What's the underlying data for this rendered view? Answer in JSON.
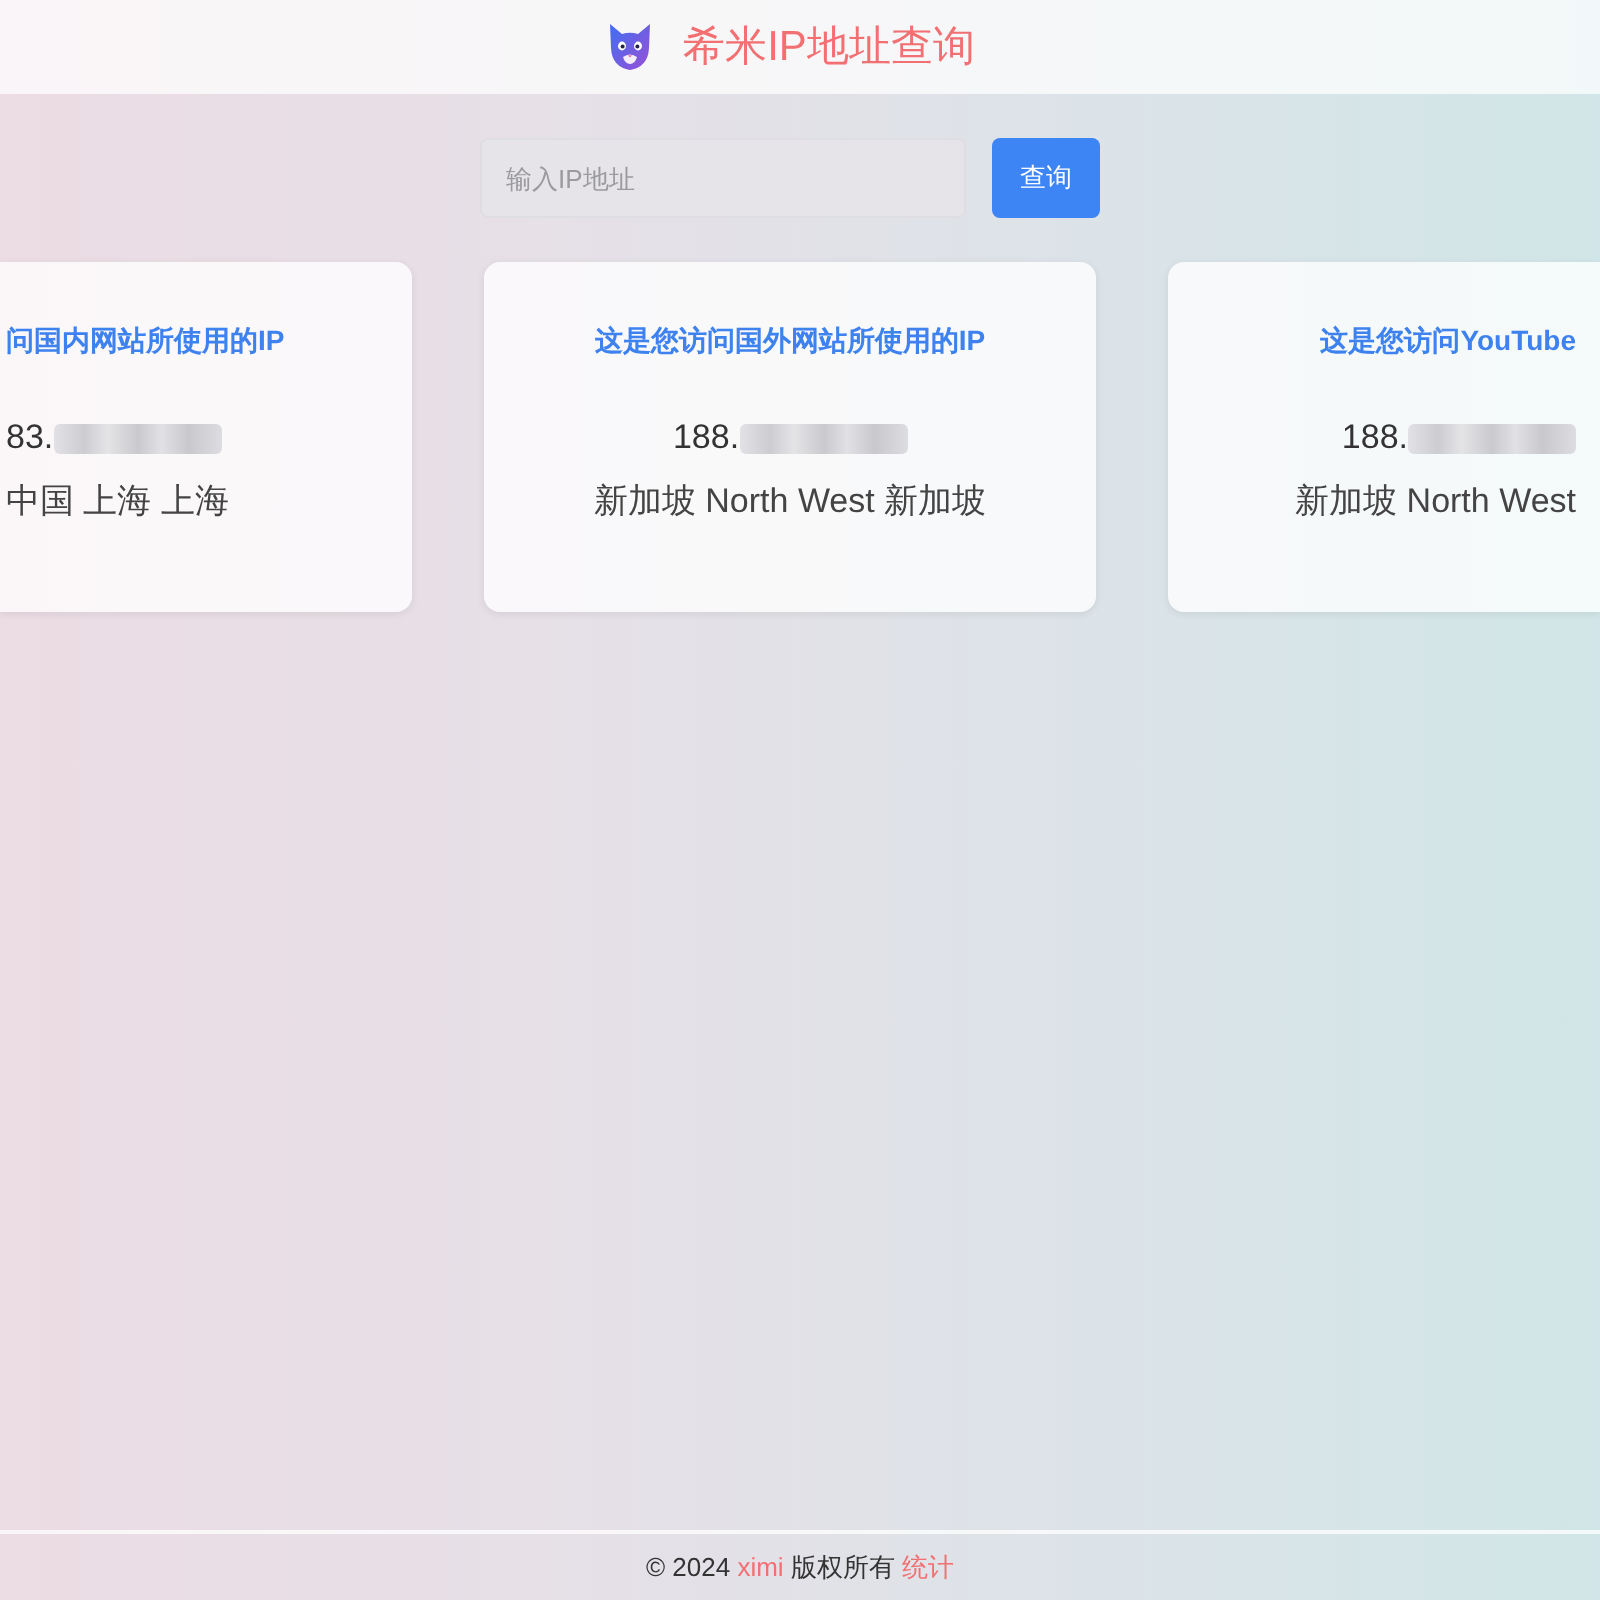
{
  "header": {
    "title": "希米IP地址查询"
  },
  "search": {
    "placeholder": "输入IP地址",
    "button": "查询"
  },
  "cards": [
    {
      "title": "问国内网站所使用的IP",
      "ip": "83.",
      "ip_redacted": true,
      "location": "中国 上海 上海"
    },
    {
      "title": "这是您访问国外网站所使用的IP",
      "ip": "188.",
      "ip_redacted": true,
      "location": "新加坡 North West 新加坡"
    },
    {
      "title": "这是您访问YouTube",
      "ip": "188.",
      "ip_redacted": true,
      "location": "新加坡 North West"
    }
  ],
  "footer": {
    "copyright": "© 2024",
    "owner_link": "ximi",
    "rights": "版权所有",
    "stats_link": "统计"
  }
}
